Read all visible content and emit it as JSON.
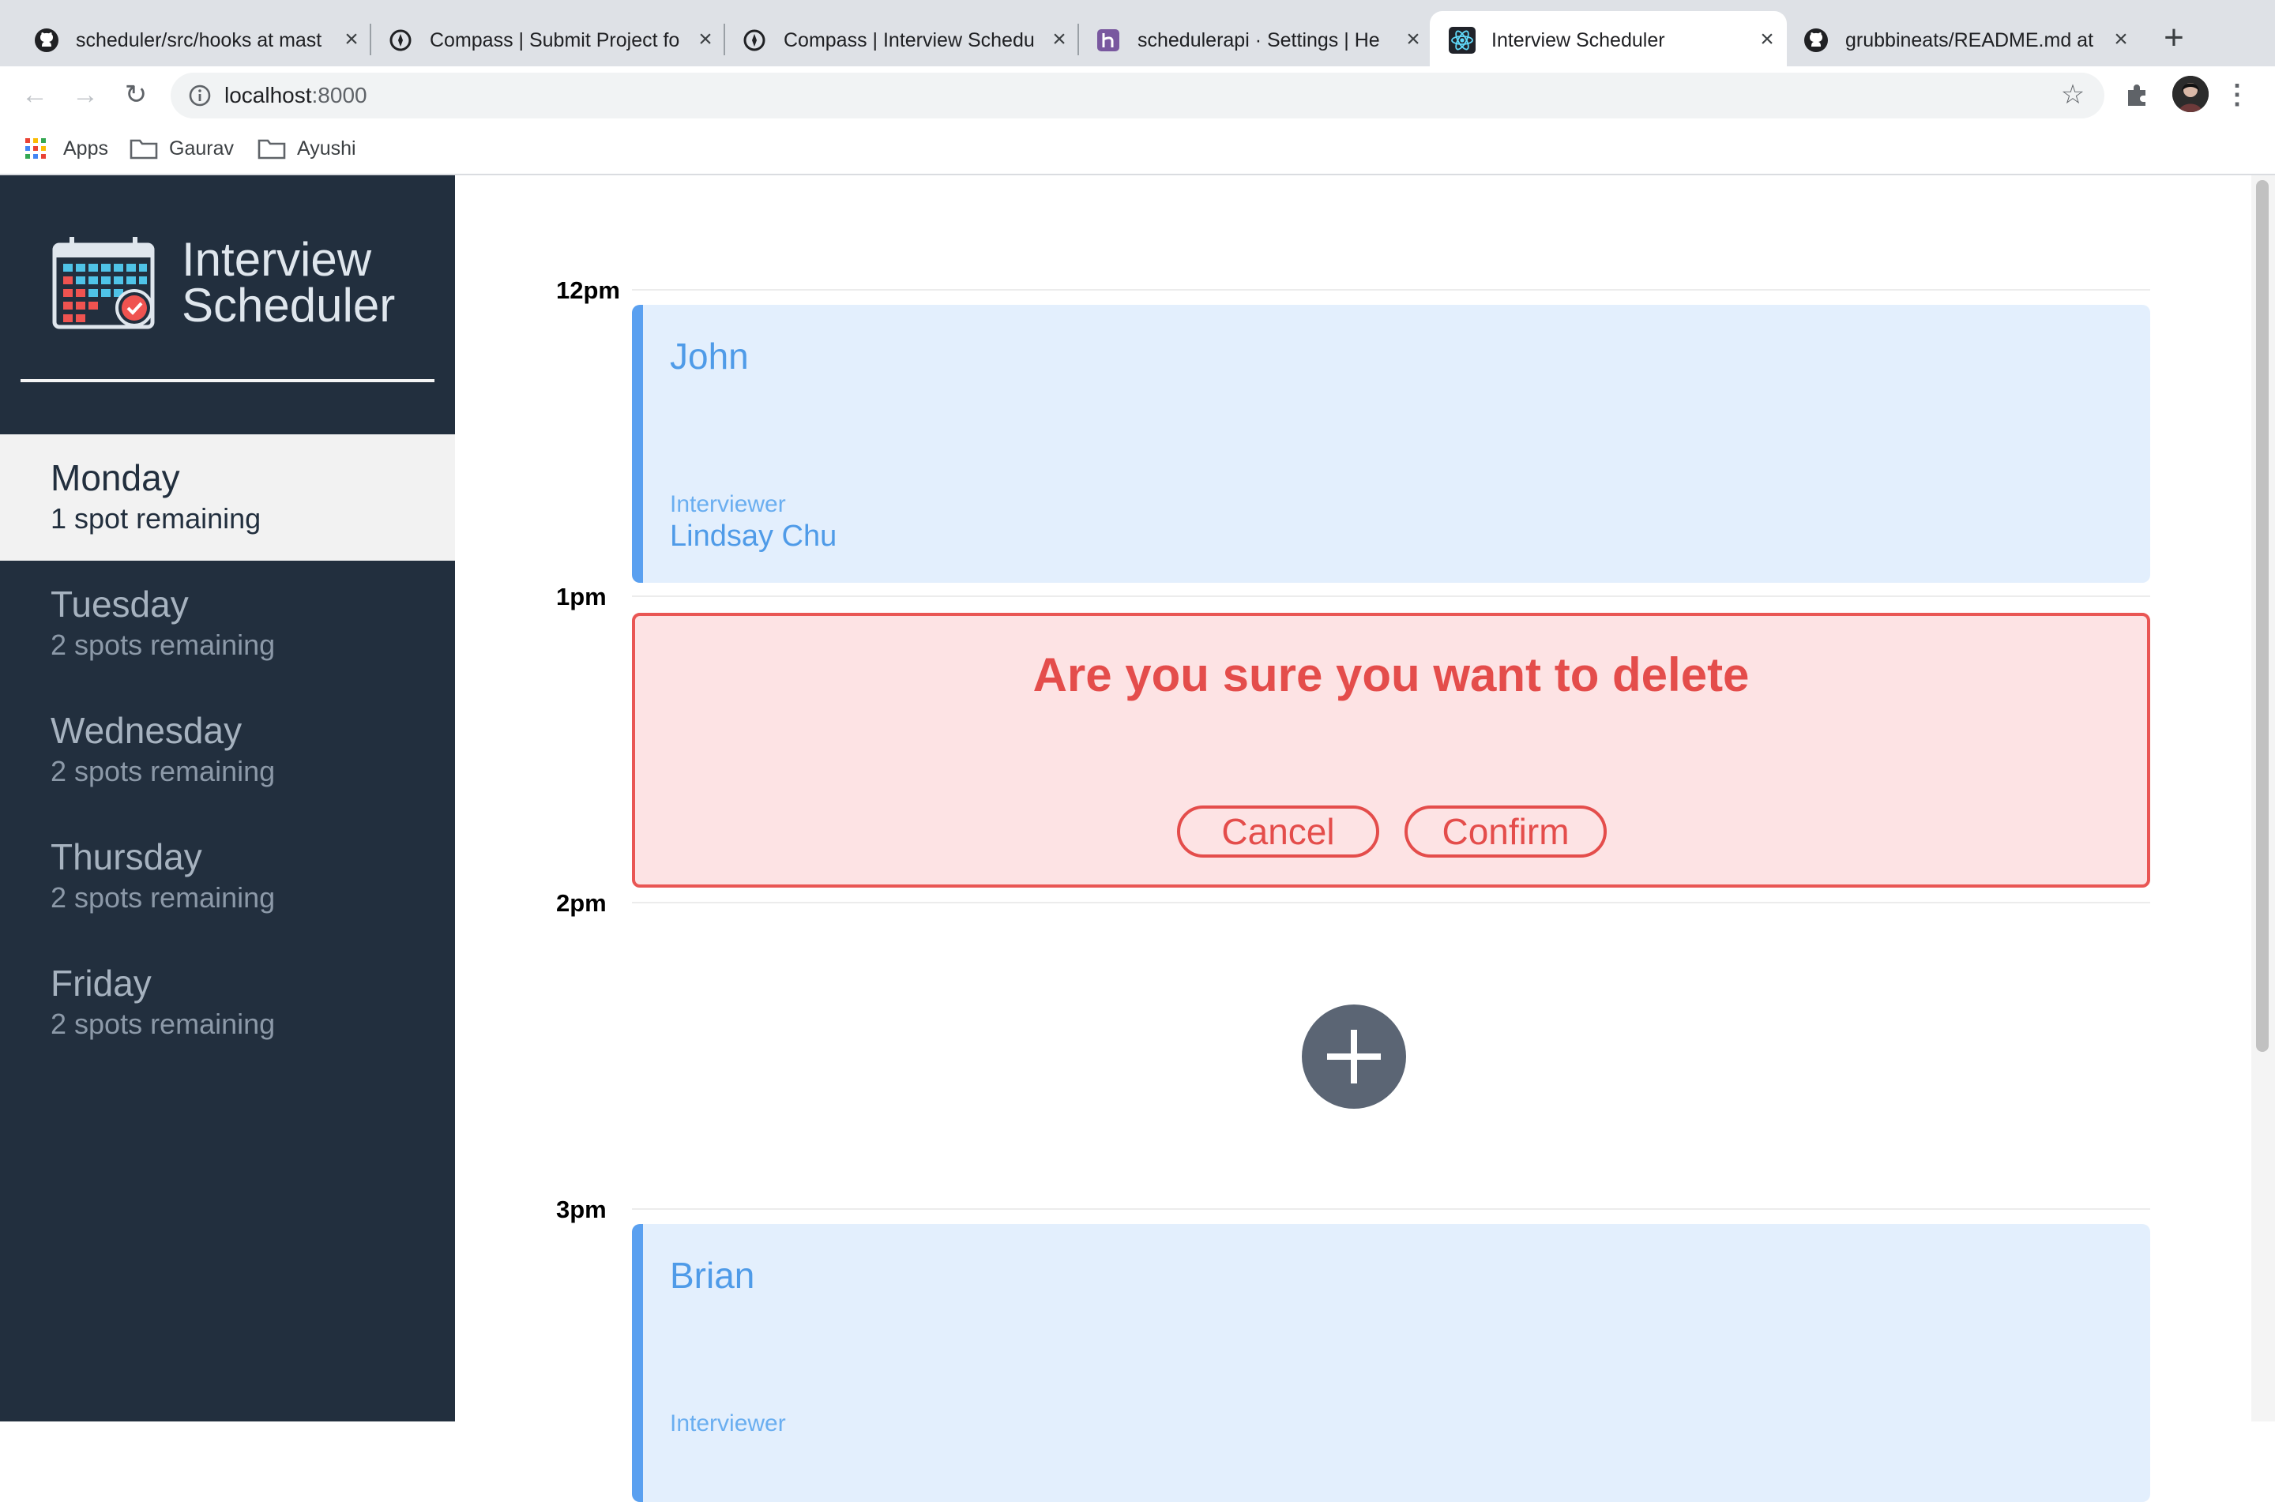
{
  "browser": {
    "tabs": [
      {
        "title": "scheduler/src/hooks at mast",
        "icon": "github-icon",
        "active": false
      },
      {
        "title": "Compass | Submit Project fo",
        "icon": "compass-icon",
        "active": false
      },
      {
        "title": "Compass | Interview Schedu",
        "icon": "compass-icon",
        "active": false
      },
      {
        "title": "schedulerapi · Settings | He",
        "icon": "heroku-icon",
        "active": false
      },
      {
        "title": "Interview Scheduler",
        "icon": "react-icon",
        "active": true
      },
      {
        "title": "grubbineats/README.md at",
        "icon": "github-icon",
        "active": false
      }
    ],
    "address": {
      "host": "localhost",
      "port": ":8000"
    },
    "bookmarks": [
      {
        "label": "Apps",
        "icon": "apps-grid-icon"
      },
      {
        "label": "Gaurav",
        "icon": "folder-icon"
      },
      {
        "label": "Ayushi",
        "icon": "folder-icon"
      }
    ]
  },
  "sidebar": {
    "brand_line1": "Interview",
    "brand_line2": "Scheduler",
    "days": [
      {
        "name": "Monday",
        "spots": "1 spot remaining",
        "selected": true
      },
      {
        "name": "Tuesday",
        "spots": "2 spots remaining",
        "selected": false
      },
      {
        "name": "Wednesday",
        "spots": "2 spots remaining",
        "selected": false
      },
      {
        "name": "Thursday",
        "spots": "2 spots remaining",
        "selected": false
      },
      {
        "name": "Friday",
        "spots": "2 spots remaining",
        "selected": false
      }
    ]
  },
  "schedule": {
    "times": [
      "12pm",
      "1pm",
      "2pm",
      "3pm"
    ],
    "appointments": [
      {
        "student": "John",
        "interviewer_label": "Interviewer",
        "interviewer": "Lindsay Chu"
      },
      {
        "student": "Brian",
        "interviewer_label": "Interviewer",
        "interviewer": ""
      }
    ],
    "confirm": {
      "message": "Are you sure you want to delete",
      "cancel_label": "Cancel",
      "confirm_label": "Confirm"
    }
  },
  "colors": {
    "sidebar_bg": "#222f3e",
    "appointment_bg": "#e3effd",
    "appointment_accent": "#5aa0f0",
    "confirm_bg": "#fde3e4",
    "confirm_accent": "#e44d4b",
    "add_button": "#5b6574"
  }
}
